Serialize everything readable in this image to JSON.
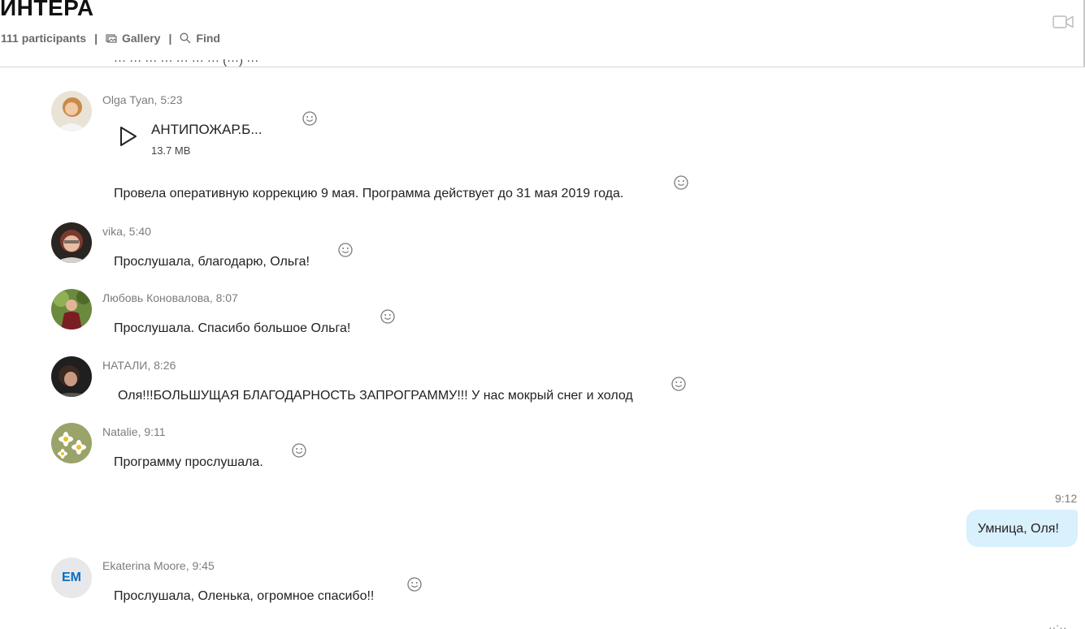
{
  "header": {
    "title": "ИНТЕРА",
    "participants": "111 participants",
    "separator": "|",
    "gallery_label": "Gallery",
    "find_label": "Find"
  },
  "messages": [
    {
      "author_time": "Olga Tyan, 5:23",
      "file_name": "АНТИПОЖАР.Б...",
      "file_size": "13.7 MB",
      "text": "Провела оперативную коррекцию 9 мая. Программа действует до 31 мая 2019 года."
    },
    {
      "author_time": "vika, 5:40",
      "text": "Прослушала, благодарю, Ольга!"
    },
    {
      "author_time": "Любовь Коновалова, 8:07",
      "text": "Прослушала. Спасибо большое Ольга!"
    },
    {
      "author_time": "НАТАЛИ, 8:26",
      "text": "Оля!!!БОЛЬШУЩАЯ БЛАГОДАРНОСТЬ ЗАПРОГРАММУ!!! У нас мокрый снег и холод"
    },
    {
      "author_time": "Natalie, 9:11",
      "text": "Программу прослушала."
    },
    {
      "author_time": "Ekaterina Moore, 9:45",
      "avatar_initials": "EM",
      "text": "Прослушала, Оленька, огромное спасибо!!"
    }
  ],
  "outgoing": {
    "time": "9:12",
    "text": "Умница, Оля!"
  },
  "colors": {
    "outgoing_bubble": "#d9f0fd",
    "initials": "#0a6fc2",
    "meta": "#7c7c7c"
  },
  "icons": [
    "gallery-icon",
    "search-icon",
    "video-call-icon",
    "play-icon",
    "smiley-reaction-icon"
  ]
}
